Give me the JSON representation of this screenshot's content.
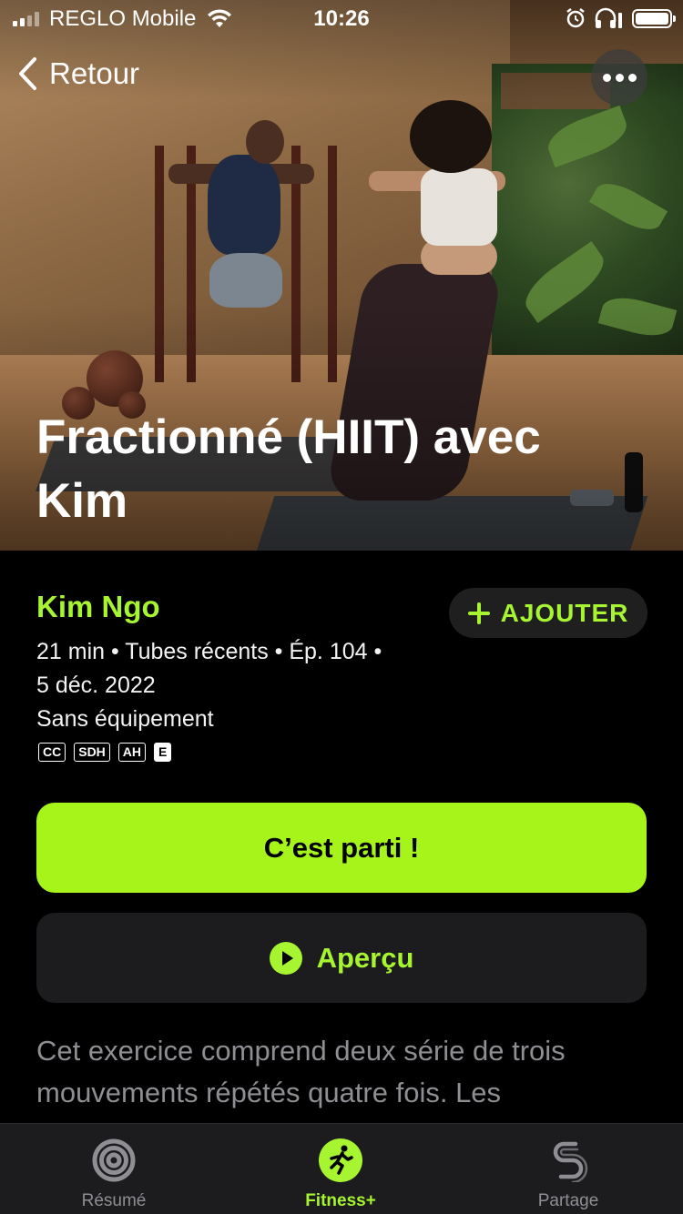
{
  "status_bar": {
    "carrier": "REGLO Mobile",
    "time": "10:26"
  },
  "nav": {
    "back_label": "Retour"
  },
  "workout": {
    "title": "Fractionné (HIIT) avec Kim",
    "trainer": "Kim Ngo",
    "meta_line1": "21 min • Tubes récents • Ép. 104 •",
    "meta_line2": "5 déc. 2022",
    "equipment": "Sans équipement",
    "badges": [
      "CC",
      "SDH",
      "AH",
      "E"
    ],
    "add_label": "AJOUTER",
    "start_label": "C’est parti !",
    "preview_label": "Aperçu",
    "description": "Cet exercice comprend deux série de trois mouvements répétés quatre fois. Les mouvements se concentrent sur le bas du corps."
  },
  "tabs": [
    {
      "label": "Résumé",
      "icon": "activity-rings-icon"
    },
    {
      "label": "Fitness+",
      "icon": "running-figure-icon"
    },
    {
      "label": "Partage",
      "icon": "sharing-icon"
    }
  ],
  "colors": {
    "accent": "#a7f430",
    "background": "#000000",
    "surface": "#1c1c1e",
    "secondary_text": "#8e8e93"
  }
}
